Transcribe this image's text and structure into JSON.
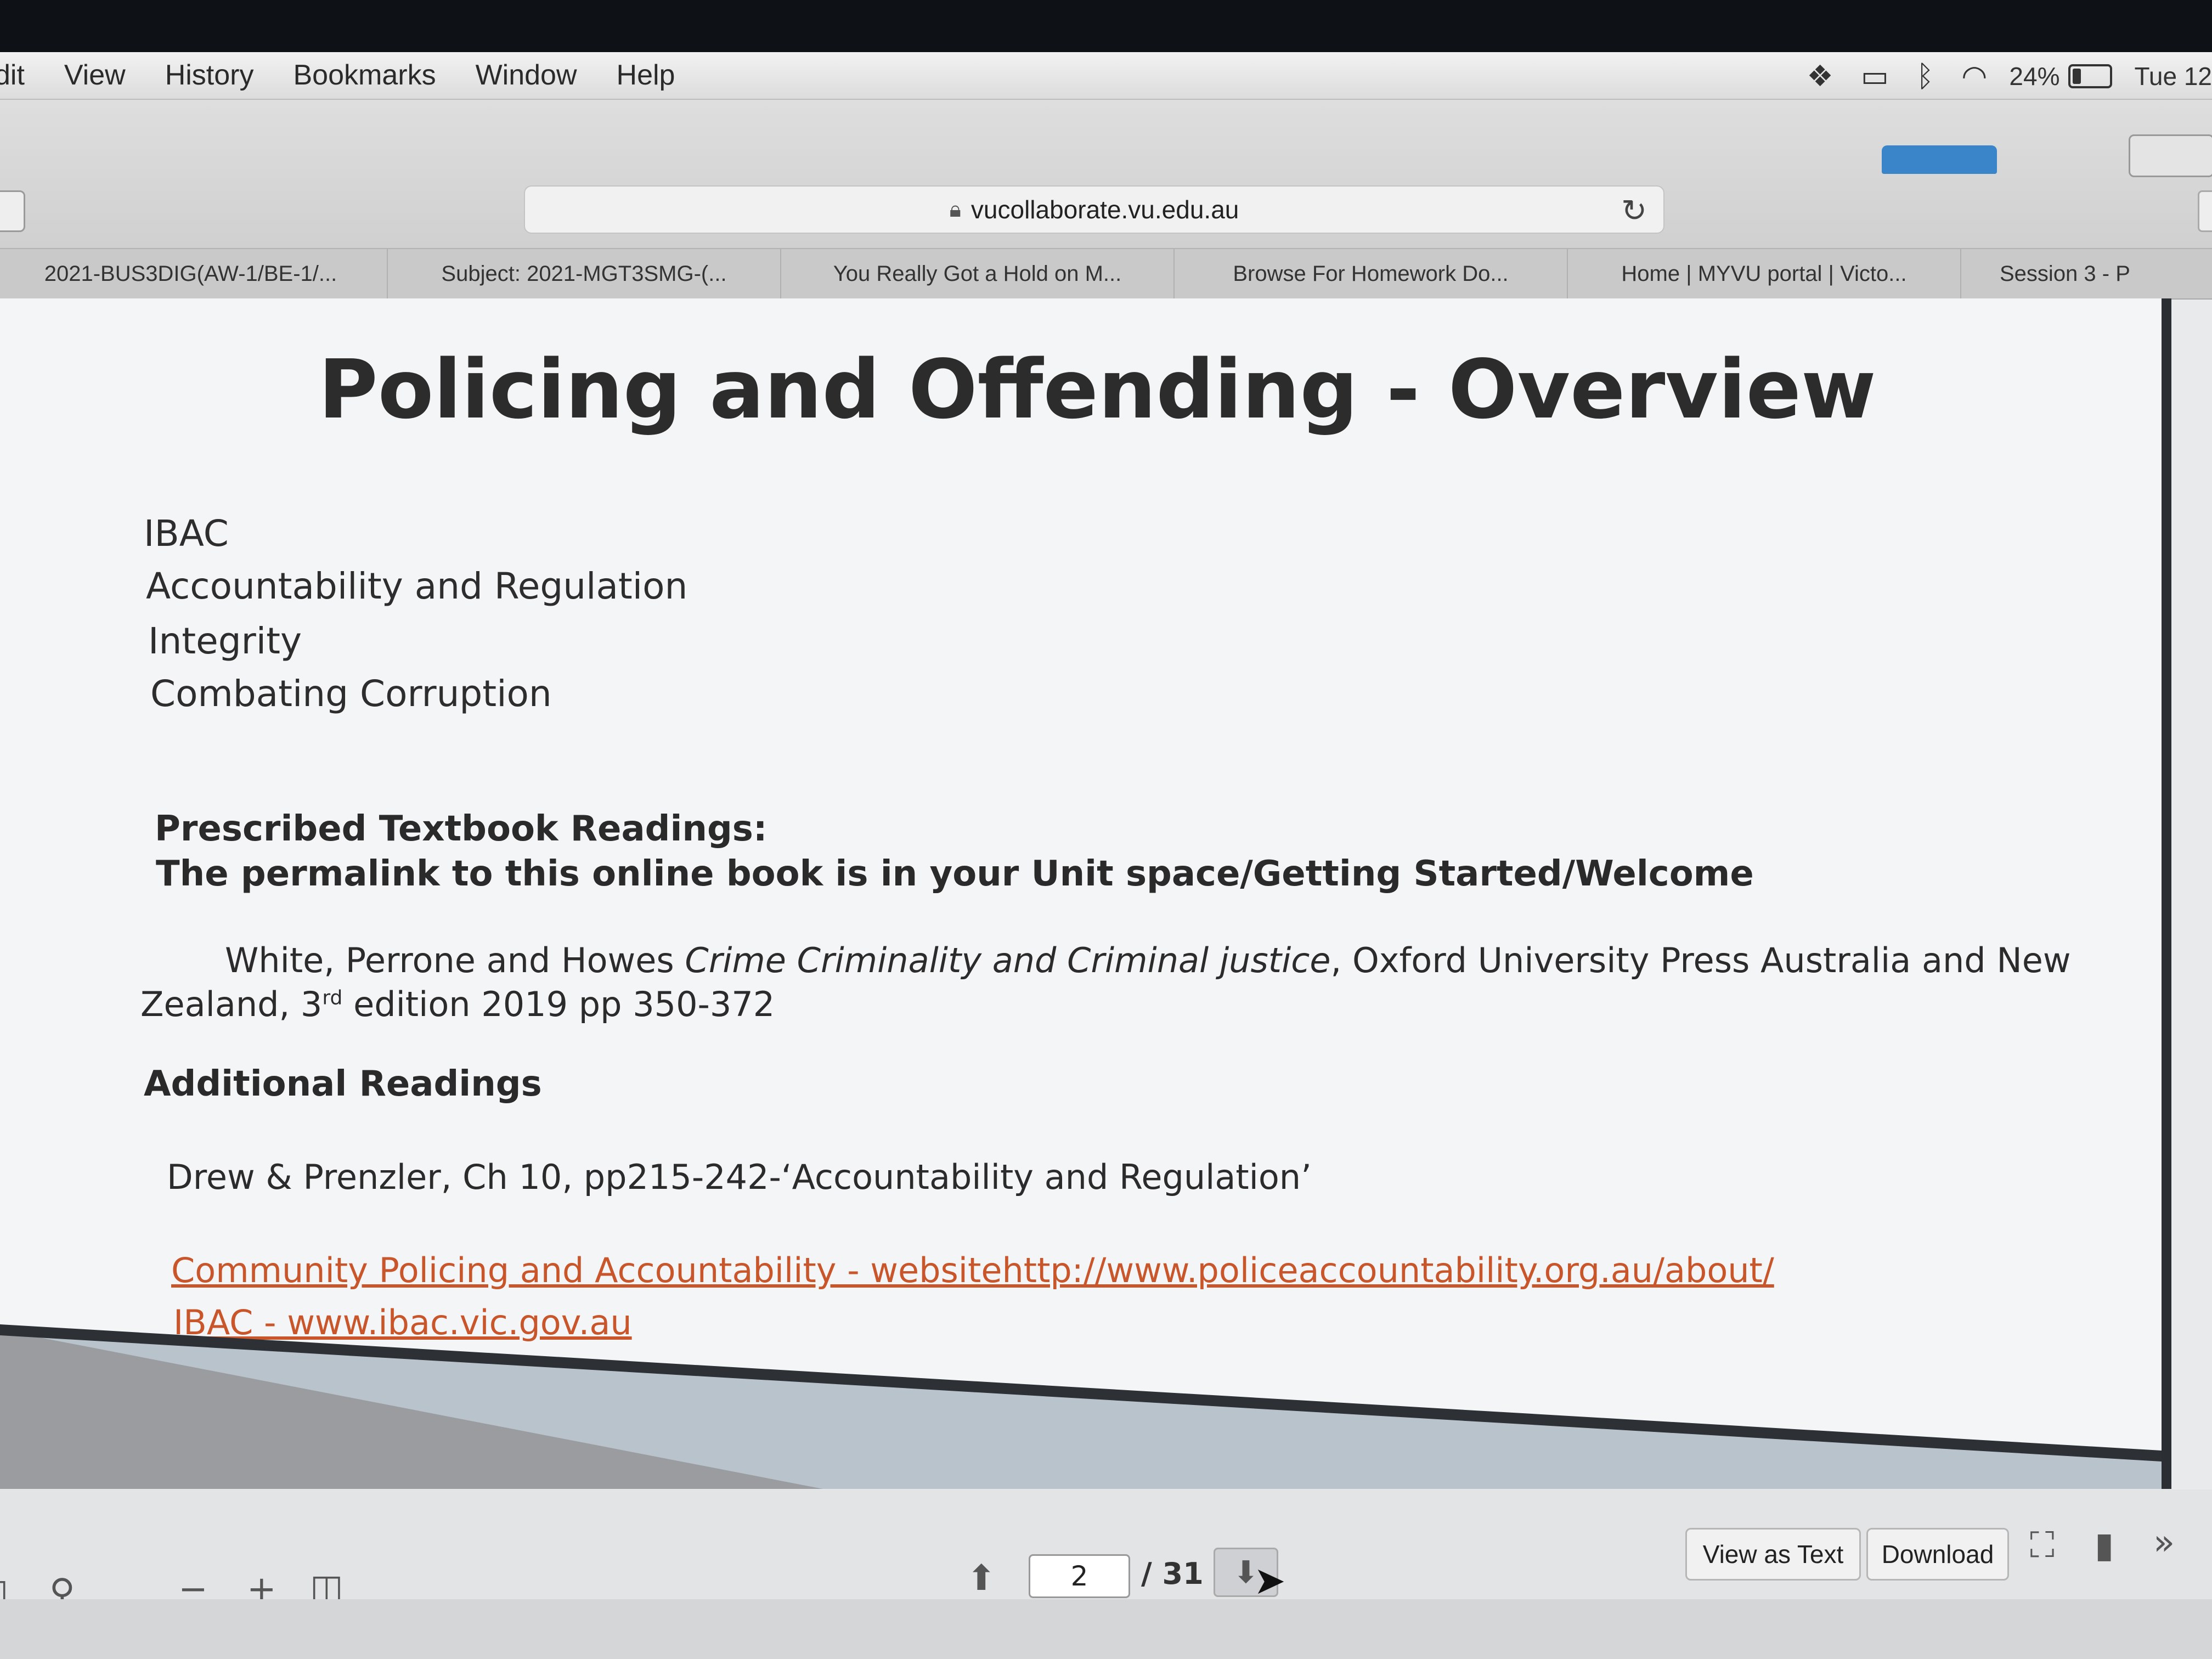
{
  "menubar": {
    "items": [
      "dit",
      "View",
      "History",
      "Bookmarks",
      "Window",
      "Help"
    ],
    "battery_percent": "24%",
    "battery_level": 0.24,
    "clock": "Tue 12"
  },
  "toolbar": {
    "url": "vucollaborate.vu.edu.au"
  },
  "tabs": [
    "2021-BUS3DIG(AW-1/BE-1/...",
    "Subject: 2021-MGT3SMG-(...",
    "You Really Got a Hold on M...",
    "Browse For Homework Do...",
    "Home | MYVU portal | Victo...",
    "Session 3 - P"
  ],
  "document": {
    "title": "Policing and Offending - Overview",
    "topics": [
      "IBAC",
      "Accountability and Regulation",
      "Integrity",
      "Combating Corruption"
    ],
    "prescribed_heading": "Prescribed Textbook Readings:",
    "permalink_line": "The permalink to this online book is in your Unit space/Getting Started/Welcome",
    "textbook_ref": {
      "authors": "White, Perrone and Howes ",
      "title_italic": "Crime Criminality and Criminal justice",
      "publisher": ", Oxford University Press    Australia and New",
      "line2_pre": "Zealand, 3",
      "line2_sup": "rd",
      "line2_post": " edition 2019 pp 350-372"
    },
    "additional_heading": "Additional Readings",
    "additional_ref": "Drew & Prenzler, Ch 10, pp215-242-‘Accountability and Regulation’",
    "link1": "Community Policing and Accountability -  websitehttp://www.policeaccountability.org.au/about/",
    "link2": "IBAC - www.ibac.vic.gov.au"
  },
  "pdf_toolbar": {
    "page_current": "2",
    "page_total": "/ 31",
    "view_as_text": "View as Text",
    "download": "Download"
  }
}
